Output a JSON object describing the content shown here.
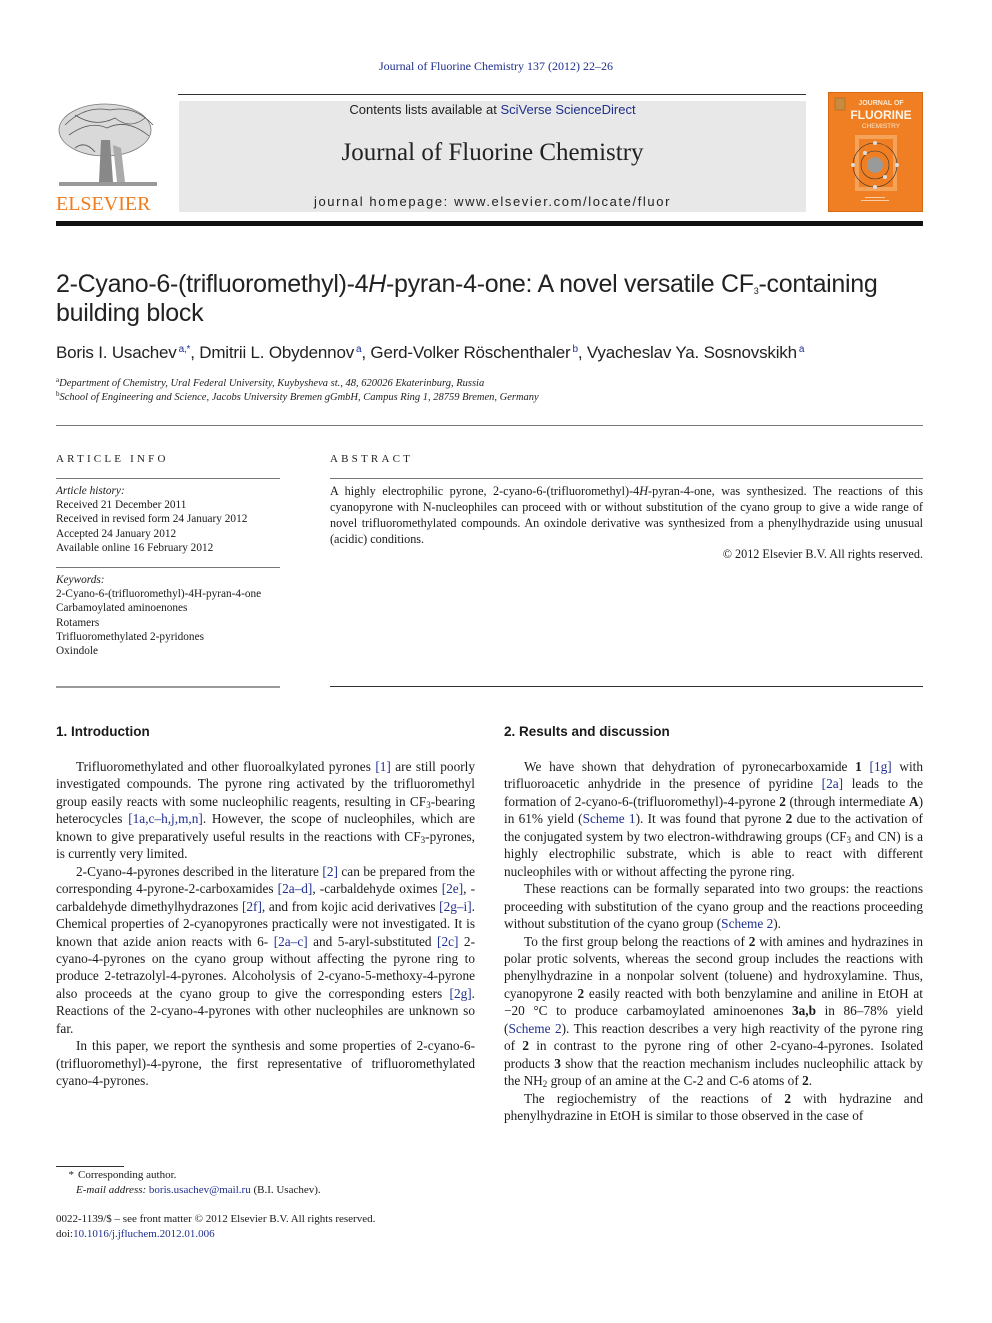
{
  "header": {
    "citation": "Journal of Fluorine Chemistry 137 (2012) 22–26",
    "contents_prefix": "Contents lists available at ",
    "contents_link": "SciVerse ScienceDirect",
    "journal_name": "Journal of Fluorine Chemistry",
    "homepage": "journal homepage: www.elsevier.com/locate/fluor",
    "publisher": "ELSEVIER",
    "cover": {
      "line1": "JOURNAL OF",
      "line2": "FLUORINE",
      "line3": "CHEMISTRY"
    },
    "colors": {
      "publisher_orange": "#f07c1c",
      "cover_orange": "#ef7f22",
      "link_blue": "#1f2f8f",
      "banner_gray": "#e8e8e8"
    }
  },
  "article": {
    "title_part1": "2-Cyano-6-(trifluoromethyl)-4",
    "title_italic": "H",
    "title_part2": "-pyran-4-one: A novel versatile CF",
    "title_sub": "3",
    "title_part3": "-containing building block",
    "authors": [
      {
        "name": "Boris I. Usachev",
        "sup": "a,*"
      },
      {
        "name": "Dmitrii L. Obydennov",
        "sup": "a"
      },
      {
        "name": "Gerd-Volker Röschenthaler",
        "sup": "b"
      },
      {
        "name": "Vyacheslav Ya. Sosnovskikh",
        "sup": "a"
      }
    ],
    "affiliations": [
      {
        "sup": "a",
        "text": "Department of Chemistry, Ural Federal University, Kuybysheva st., 48, 620026 Ekaterinburg, Russia"
      },
      {
        "sup": "b",
        "text": "School of Engineering and Science, Jacobs University Bremen gGmbH, Campus Ring 1, 28759 Bremen, Germany"
      }
    ]
  },
  "article_info": {
    "heading": "ARTICLE INFO",
    "history_label": "Article history:",
    "history": [
      "Received 21 December 2011",
      "Received in revised form 24 January 2012",
      "Accepted 24 January 2012",
      "Available online 16 February 2012"
    ],
    "keywords_label": "Keywords:",
    "keywords": [
      "2-Cyano-6-(trifluoromethyl)-4H-pyran-4-one",
      "Carbamoylated aminoenones",
      "Rotamers",
      "Trifluoromethylated 2-pyridones",
      "Oxindole"
    ]
  },
  "abstract": {
    "heading": "ABSTRACT",
    "text_a": "A highly electrophilic pyrone, 2-cyano-6-(trifluoromethyl)-4",
    "text_italic": "H",
    "text_b": "-pyran-4-one, was synthesized. The reactions of this cyanopyrone with N-nucleophiles can proceed with or without substitution of the cyano group to give a wide range of novel trifluoromethylated compounds. An oxindole derivative was synthesized from a phenylhydrazide using unusual (acidic) conditions.",
    "copyright": "© 2012 Elsevier B.V. All rights reserved."
  },
  "intro": {
    "heading": "1.  Introduction",
    "p1": {
      "t1": "Trifluoromethylated and other fluoroalkylated pyrones ",
      "r1": "[1]",
      "t2": " are still poorly investigated compounds. The pyrone ring activated by the trifluoromethyl group easily reacts with some nucleophilic reagents, resulting in CF",
      "t3": "-bearing heterocycles ",
      "r2": "[1a,c–h,j,m,n]",
      "t4": ". However, the scope of nucleophiles, which are known to give preparatively useful results in the reactions with CF",
      "t5": "-pyrones, is currently very limited."
    },
    "p2": {
      "t1": "2-Cyano-4-pyrones described in the literature ",
      "r1": "[2]",
      "t2": " can be prepared from the corresponding 4-pyrone-2-carboxamides ",
      "r2": "[2a–d]",
      "t3": ", -carbaldehyde oximes ",
      "r3": "[2e]",
      "t4": ", -carbaldehyde dimethylhydrazones ",
      "r4": "[2f]",
      "t5": ", and from kojic acid derivatives ",
      "r5": "[2g–i]",
      "t6": ". Chemical properties of 2-cyanopyrones practically were not investigated. It is known that azide anion reacts with 6- ",
      "r6": "[2a–c]",
      "t7": " and 5-aryl-substituted ",
      "r7": "[2c]",
      "t8": " 2-cyano-4-pyrones on the cyano group without affecting the pyrone ring to produce 2-tetrazolyl-4-pyrones. Alcoholysis of 2-cyano-5-methoxy-4-pyrone also proceeds at the cyano group to give the corresponding esters ",
      "r8": "[2g]",
      "t9": ". Reactions of the 2-cyano-4-pyrones with other nucleophiles are unknown so far."
    },
    "p3": "In this paper, we report the synthesis and some properties of 2-cyano-6-(trifluoromethyl)-4-pyrone, the first representative of trifluoromethylated cyano-4-pyrones."
  },
  "results": {
    "heading": "2.  Results and discussion",
    "p1": {
      "t1": "We have shown that dehydration of pyronecarboxamide ",
      "b1": "1",
      "r1": "[1g]",
      "t2": " with trifluoroacetic anhydride in the presence of pyridine ",
      "r2": "[2a]",
      "t3": " leads to the formation of 2-cyano-6-(trifluoromethyl)-4-pyrone ",
      "b2": "2",
      "t4": " (through intermediate ",
      "b3": "A",
      "t5": ") in 61% yield (",
      "r3": "Scheme 1",
      "t6": "). It was found that pyrone ",
      "b4": "2",
      "t7": " due to the activation of the conjugated system by two electron-withdrawing groups (CF",
      "t8": " and CN) is a highly electrophilic substrate, which is able to react with different nucleophiles with or without affecting the pyrone ring."
    },
    "p2": {
      "t1": "These reactions can be formally separated into two groups: the reactions proceeding with substitution of the cyano group and the reactions proceeding without substitution of the cyano group (",
      "r1": "Scheme 2",
      "t2": ")."
    },
    "p3": {
      "t1": "To the first group belong the reactions of ",
      "b1": "2",
      "t2": " with amines and hydrazines in polar protic solvents, whereas the second group includes the reactions with phenylhydrazine in a nonpolar solvent (toluene) and hydroxylamine. Thus, cyanopyrone ",
      "b2": "2",
      "t3": " easily reacted with both benzylamine and aniline in EtOH at −20 °C to produce carbamoylated aminoenones ",
      "b3": "3a,b",
      "t4": " in 86–78% yield (",
      "r1": "Scheme 2",
      "t5": "). This reaction describes a very high reactivity of the pyrone ring of ",
      "b4": "2",
      "t6": " in contrast to the pyrone ring of other 2-cyano-4-pyrones. Isolated products ",
      "b5": "3",
      "t7": " show that the reaction mechanism includes nucleophilic attack by the NH",
      "t8": " group of an amine at the C-2 and C-6 atoms of ",
      "b6": "2",
      "t9": "."
    },
    "p4": {
      "t1": "The regiochemistry of the reactions of ",
      "b1": "2",
      "t2": " with hydrazine and phenylhydrazine in EtOH is similar to those observed in the case of"
    },
    "sub3": "3",
    "sub2": "2"
  },
  "footnote": {
    "star": "*",
    "corresponding": "Corresponding author.",
    "email_label": "E-mail address:",
    "email": "boris.usachev@mail.ru",
    "email_suffix": " (B.I. Usachev).",
    "issn": "0022-1139/$ – see front matter © 2012 Elsevier B.V. All rights reserved.",
    "doi_prefix": "doi:",
    "doi": "10.1016/j.jfluchem.2012.01.006"
  }
}
